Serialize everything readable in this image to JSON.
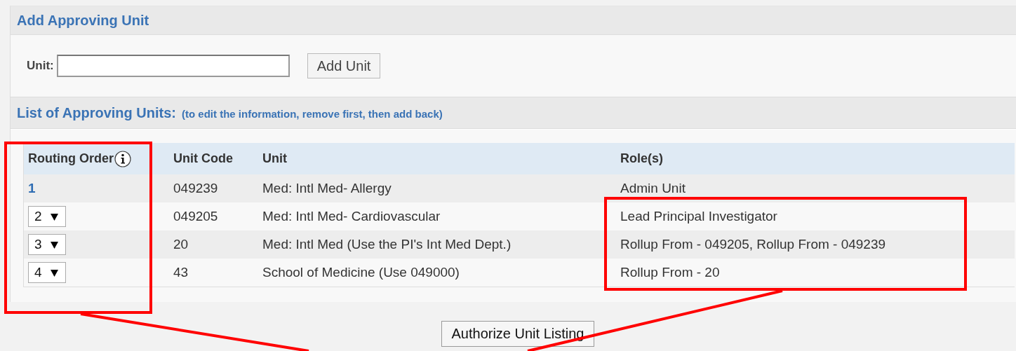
{
  "add_section": {
    "title": "Add Approving Unit",
    "unit_label": "Unit:",
    "add_button": "Add Unit"
  },
  "list_section": {
    "title": "List of Approving Units:",
    "note": "(to edit the information, remove first, then add back)"
  },
  "table": {
    "columns": [
      {
        "label": "Routing Order",
        "info": true
      },
      {
        "label": "Unit Code",
        "info": false
      },
      {
        "label": "Unit",
        "info": false
      },
      {
        "label": "Role(s)",
        "info": false
      }
    ],
    "rows": [
      {
        "routing_order": {
          "kind": "link",
          "value": "1"
        },
        "unit_code": "049239",
        "unit": "Med: Intl Med- Allergy",
        "roles": "Admin Unit"
      },
      {
        "routing_order": {
          "kind": "select",
          "value": "2"
        },
        "unit_code": "049205",
        "unit": "Med: Intl Med- Cardiovascular",
        "roles": "Lead Principal Investigator"
      },
      {
        "routing_order": {
          "kind": "select",
          "value": "3"
        },
        "unit_code": "20",
        "unit": "Med: Intl Med (Use the PI's Int Med Dept.)",
        "roles": "Rollup From - 049205, Rollup From - 049239"
      },
      {
        "routing_order": {
          "kind": "select",
          "value": "4"
        },
        "unit_code": "43",
        "unit": "School of Medicine (Use 049000)",
        "roles": "Rollup From - 20"
      }
    ]
  },
  "authorize_button": "Authorize Unit Listing"
}
